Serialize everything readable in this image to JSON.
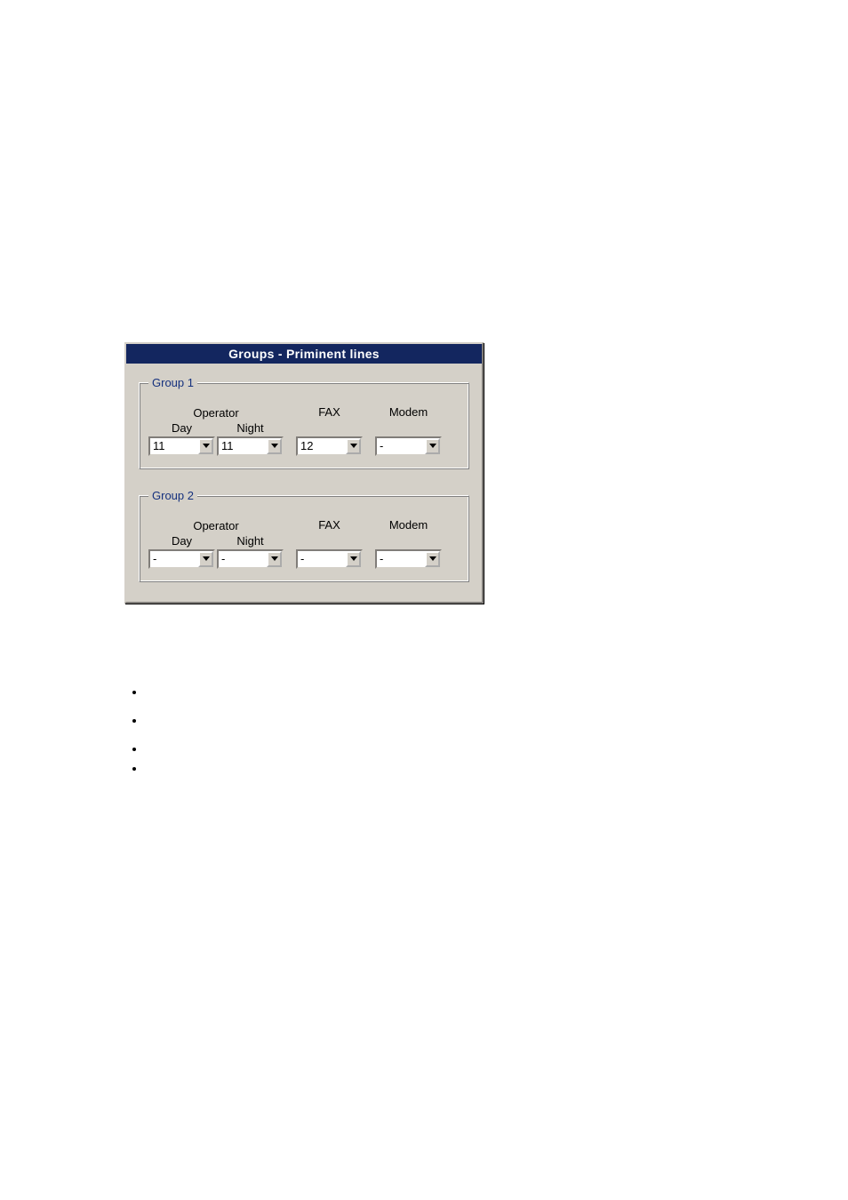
{
  "dialog": {
    "title": "Groups - Priminent lines"
  },
  "group1": {
    "legend": "Group 1",
    "operator_label": "Operator",
    "day_label": "Day",
    "night_label": "Night",
    "fax_label": "FAX",
    "modem_label": "Modem",
    "day_value": "11",
    "night_value": "11",
    "fax_value": "12",
    "modem_value": "-"
  },
  "group2": {
    "legend": "Group 2",
    "operator_label": "Operator",
    "day_label": "Day",
    "night_label": "Night",
    "fax_label": "FAX",
    "modem_label": "Modem",
    "day_value": "-",
    "night_value": "-",
    "fax_value": "-",
    "modem_value": "-"
  },
  "bullets": [
    "",
    "",
    "",
    ""
  ]
}
